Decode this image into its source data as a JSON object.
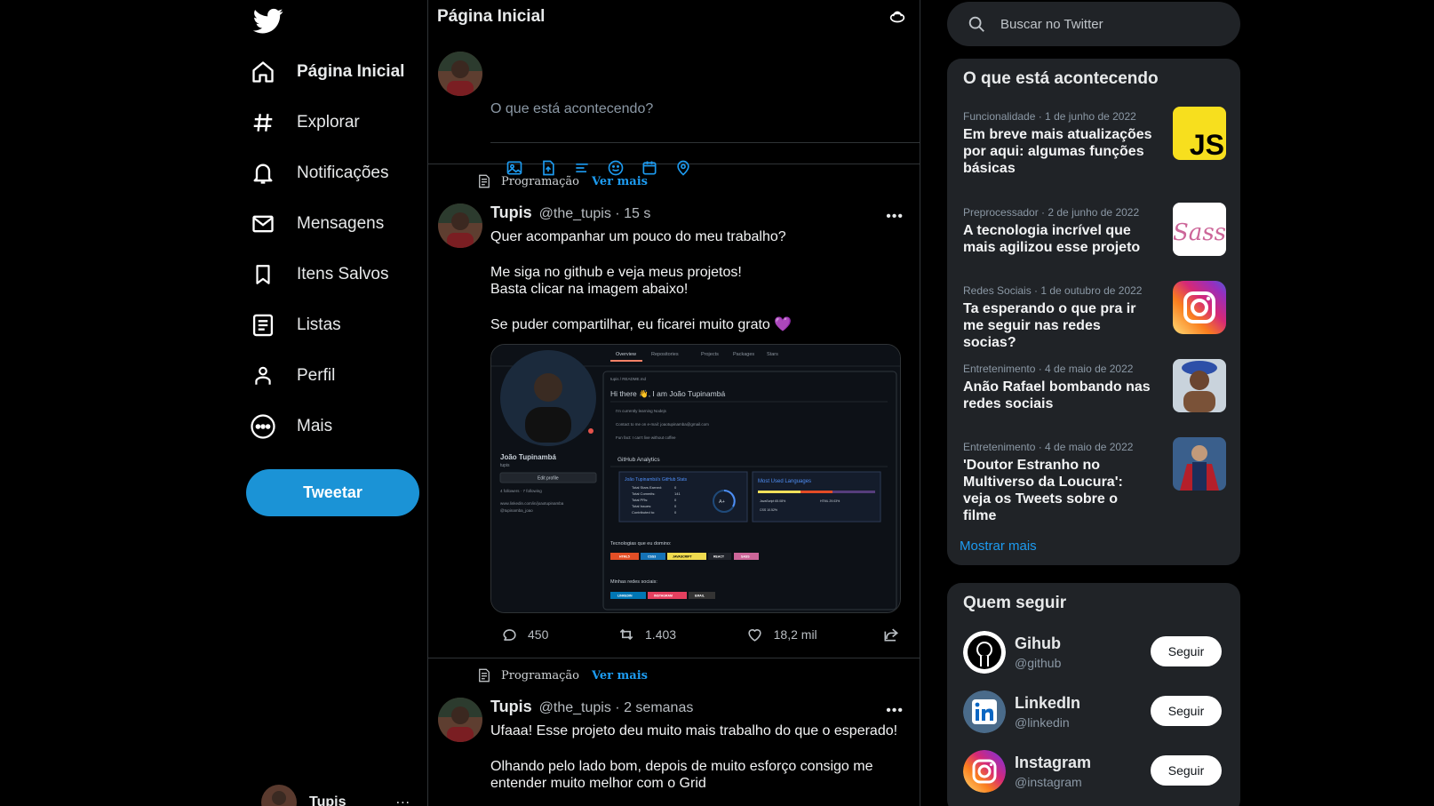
{
  "nav": {
    "items": [
      {
        "label": "Página Inicial",
        "icon": "home-icon",
        "active": true
      },
      {
        "label": "Explorar",
        "icon": "hashtag-icon"
      },
      {
        "label": "Notificações",
        "icon": "bell-icon"
      },
      {
        "label": "Mensagens",
        "icon": "mail-icon"
      },
      {
        "label": "Itens Salvos",
        "icon": "bookmark-icon"
      },
      {
        "label": "Listas",
        "icon": "list-icon"
      },
      {
        "label": "Perfil",
        "icon": "person-icon"
      },
      {
        "label": "Mais",
        "icon": "more-circle-icon"
      }
    ],
    "tweet_button": "Tweetar",
    "account": {
      "name": "Tupis",
      "more": "..."
    }
  },
  "feed": {
    "title": "Página Inicial",
    "composer_placeholder": "O que está acontecendo?",
    "tweets": [
      {
        "context": "Programação",
        "context_link": "Ver mais",
        "name": "Tupis",
        "handle_time": "@the_tupis · 15 s",
        "lines": [
          "Quer acompanhar um pouco do meu trabalho?",
          "Me siga no github e veja meus projetos!",
          "Basta clicar na imagem abaixo!",
          "Se puder compartilhar, eu ficarei muito grato"
        ],
        "emoji": "💜",
        "replies": "450",
        "retweets": "1.403",
        "likes": "18,2 mil"
      },
      {
        "context": "Programação",
        "context_link": "Ver mais",
        "name": "Tupis",
        "handle_time": "@the_tupis · 2 semanas",
        "lines": [
          "Ufaaa! Esse projeto deu muito mais trabalho do que o esperado!",
          "Olhando pelo lado bom, depois de muito esforço consigo me",
          "entender muito melhor com o Grid"
        ]
      }
    ],
    "media": {
      "tabs": [
        "Overview",
        "Repositories",
        "Projects",
        "Packages",
        "Stars"
      ],
      "profile_name": "João Tupinambá",
      "profile_user": "tupis",
      "edit_button": "Edit profile",
      "followers": "4 followers · 7 following",
      "link1": "www.linkedin.com/in/joaotupinamba",
      "link2": "@tupinamba_joao",
      "readme_path": "tupis / README.md",
      "greeting": "Hi there 👋, I am João Tupinambá",
      "bullets": [
        "I'm currently learning Nodejs",
        "Contact to me on e-mail: joaotupinamba@gmail.com",
        "Fun fact: I can't live without coffee"
      ],
      "analytics_title": "GitHub Analytics",
      "stats_title": "João Tupinambá's GitHub Stats",
      "stats": [
        {
          "label": "Total Stars Earned:",
          "value": "0"
        },
        {
          "label": "Total Commits:",
          "value": "141"
        },
        {
          "label": "Total PRs:",
          "value": "0"
        },
        {
          "label": "Total Issues:",
          "value": "0"
        },
        {
          "label": "Contributed to:",
          "value": "0"
        }
      ],
      "grade": "A+",
      "langs_title": "Most Used Languages",
      "langs": [
        "JavaScript 65.08%",
        "HTML 29.03%",
        "CSS 10.52%"
      ],
      "tech_title": "Tecnologias que eu domino:",
      "techs": [
        "HTML5",
        "CSS3",
        "JAVASCRIPT",
        "REACT",
        "SASS"
      ],
      "social_title": "Minhas redes sociais:",
      "socials": [
        "LINKEDIN",
        "INSTAGRAM",
        "EMAIL"
      ]
    }
  },
  "search": {
    "placeholder": "Buscar no Twitter"
  },
  "trends": {
    "title": "O que está acontecendo",
    "items": [
      {
        "meta": "Funcionalidade · 1 de junho de 2022",
        "text": "Em breve mais atualizações por aqui: algumas funções básicas",
        "thumb": "JS"
      },
      {
        "meta": "Preprocessador · 2 de junho de 2022",
        "text": "A tecnologia incrível que mais agilizou esse projeto",
        "thumb": "Sass"
      },
      {
        "meta": "Redes Sociais ·   1 de outubro de 2022",
        "text": "Ta esperando o que pra ir me seguir nas redes socias?",
        "thumb": "instagram"
      },
      {
        "meta": "Entretenimento · 4 de maio de 2022",
        "text": "Anão Rafael bombando nas redes sociais",
        "thumb": "photo"
      },
      {
        "meta": "Entretenimento · 4 de maio de 2022",
        "text": "'Doutor Estranho no Multiverso da Loucura': veja os Tweets sobre o filme",
        "thumb": "photo"
      }
    ],
    "show_more": "Mostrar mais"
  },
  "who_to_follow": {
    "title": "Quem seguir",
    "items": [
      {
        "name": "Gihub",
        "handle": "@github",
        "button": "Seguir"
      },
      {
        "name": "LinkedIn",
        "handle": "@linkedin",
        "button": "Seguir"
      },
      {
        "name": "Instagram",
        "handle": "@instagram",
        "button": "Seguir"
      }
    ]
  },
  "colors": {
    "accent": "#1d9bf0",
    "tweet_button": "#1b93d6",
    "panel": "#202327",
    "border": "#2f3336"
  }
}
